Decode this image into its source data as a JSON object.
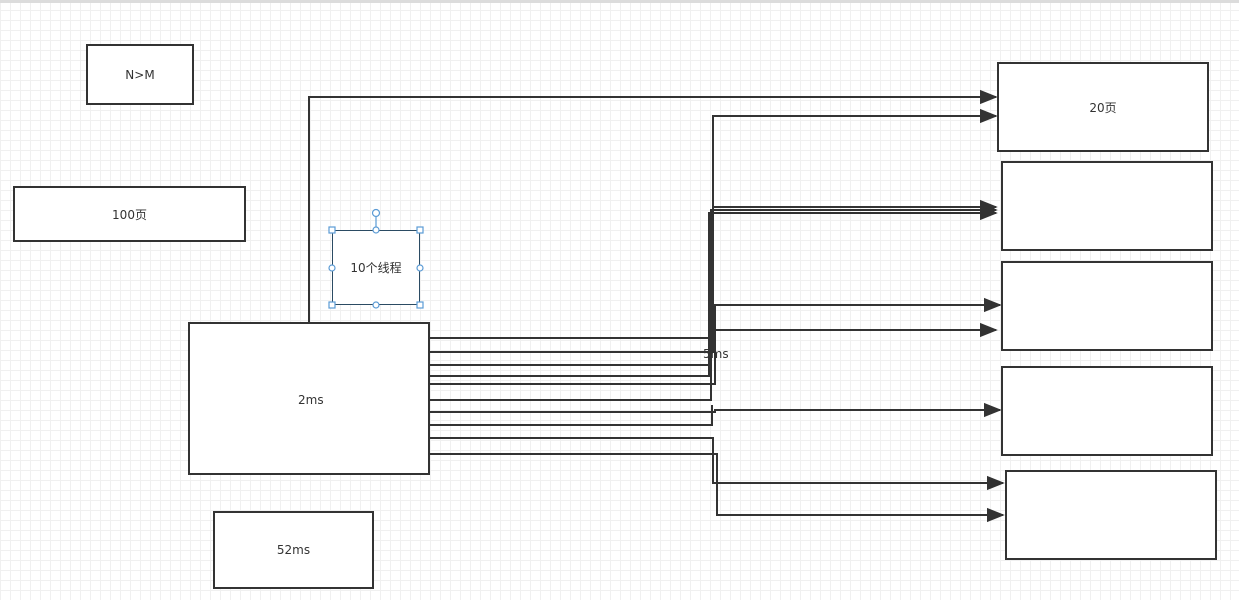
{
  "boxes": {
    "n_gt_m": "N>M",
    "page_100": "100页",
    "threads_10": "10个线程",
    "page_20": "20页",
    "ms_52": "52ms"
  },
  "labels": {
    "ms_2": "2ms",
    "ms_5x": "5ms"
  },
  "colors": {
    "stroke": "#333333",
    "selection": "#5b9bd5",
    "grid": "#f0f0f0"
  }
}
